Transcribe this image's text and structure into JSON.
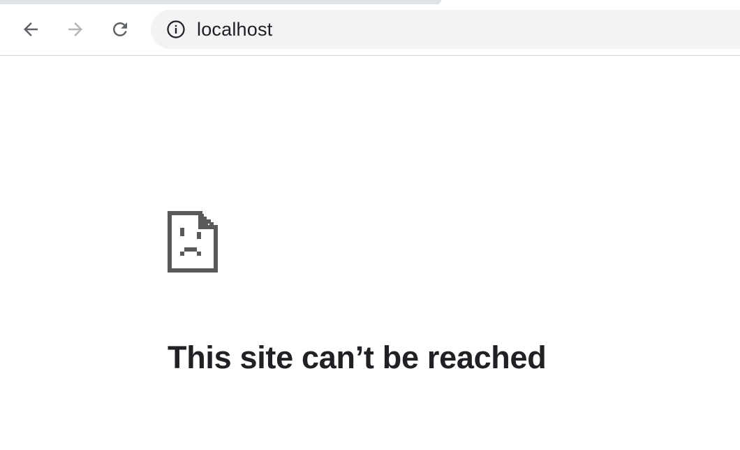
{
  "browser": {
    "toolbar": {
      "back_icon": "back-arrow-icon",
      "forward_icon": "forward-arrow-icon",
      "reload_icon": "reload-icon",
      "forward_enabled": false
    },
    "omnibox": {
      "security_icon": "info-icon",
      "url": "localhost"
    }
  },
  "page": {
    "error_icon": "sad-document-icon",
    "title": "This site can’t be reached"
  },
  "colors": {
    "text": "#202124",
    "icon": "#5f6368",
    "icon_disabled": "#b4b6b9",
    "omnibox_bg": "#f1f3f4",
    "tab_strip": "#dee1e6",
    "error_icon": "#5a5a5a"
  }
}
